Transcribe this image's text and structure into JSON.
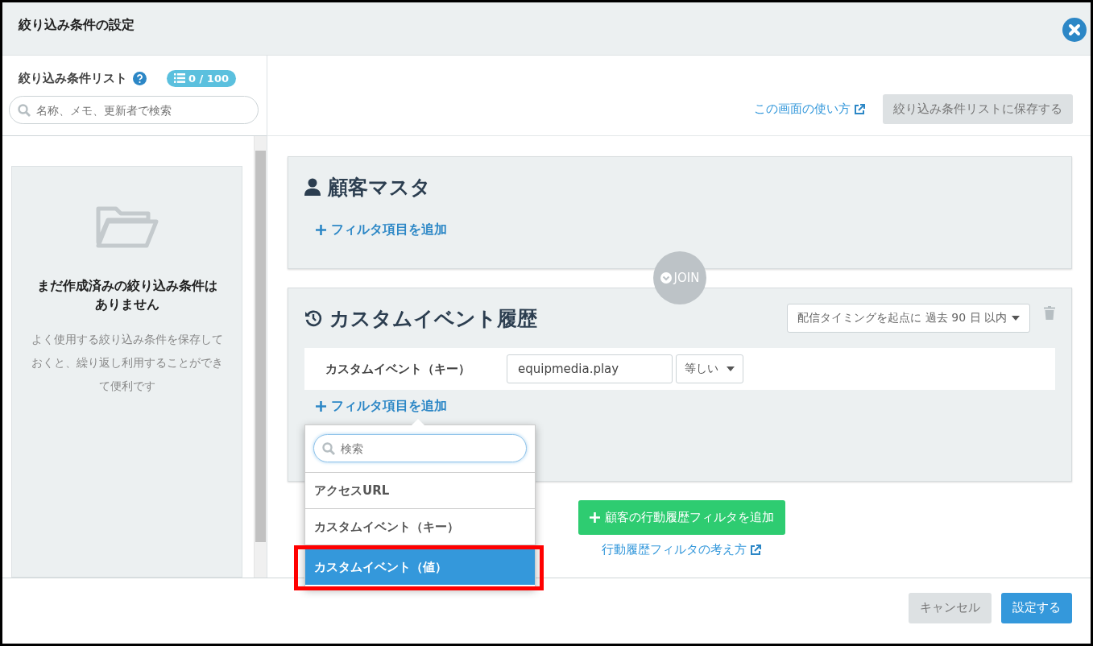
{
  "window": {
    "title": "絞り込み条件の設定"
  },
  "sidebar": {
    "title": "絞り込み条件リスト",
    "count": "0 / 100",
    "search": {
      "placeholder": "名称、メモ、更新者で検索"
    },
    "empty": {
      "heading": "まだ作成済みの絞り込み条件はありません",
      "text": "よく使用する絞り込み条件を保存しておくと、繰り返し利用することができて便利です"
    }
  },
  "toolbar": {
    "help_link": "この画面の使い方",
    "save_button": "絞り込み条件リストに保存する",
    "save_disabled": true
  },
  "sections": [
    {
      "kind": "master",
      "title": "顧客マスタ",
      "add_filter": "フィルタ項目を追加"
    },
    {
      "kind": "history",
      "title": "カスタムイベント履歴",
      "timing": "配信タイミングを起点に 過去 90 日 以内",
      "filters": [
        {
          "label": "カスタムイベント（キー）",
          "value": "equipmedia.play",
          "operator": "等しい"
        }
      ],
      "add_filter": "フィルタ項目を追加"
    }
  ],
  "join": "JOIN",
  "dropdown": {
    "search": {
      "placeholder": "検索"
    },
    "items": [
      {
        "label": "アクセスURL",
        "selected": false
      },
      {
        "label": "カスタムイベント（キー）",
        "selected": false
      },
      {
        "label": "カスタムイベント（値）",
        "selected": true
      }
    ]
  },
  "add_history_button": "顧客の行動履歴フィルタを追加",
  "history_help_link": "行動履歴フィルタの考え方",
  "footer": {
    "buttons": [
      {
        "label": "キャンセル",
        "kind": "secondary"
      },
      {
        "label": "設定する",
        "kind": "primary"
      }
    ]
  }
}
